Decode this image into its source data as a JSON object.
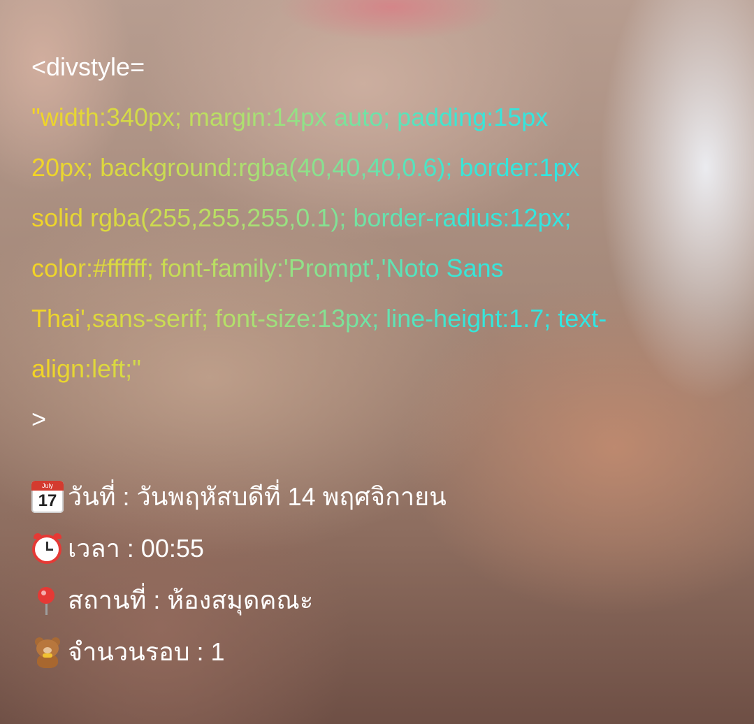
{
  "code": {
    "open_tag": "<divstyle=",
    "style_lines": [
      "\"width:340px; margin:14px auto; padding:15px",
      "20px; background:rgba(40,40,40,0.6); border:1px",
      "solid rgba(255,255,255,0.1); border-radius:12px;",
      "color:#ffffff; font-family:'Prompt','Noto Sans",
      "Thai',sans-serif; font-size:13px; line-height:1.7; text-",
      "align:left;\""
    ],
    "close_bracket": ">"
  },
  "info": {
    "calendar_badge": "July",
    "calendar_day": "17",
    "date_label": "วันที่ : วันพฤหัสบดีที่ 14 พฤศจิกายน",
    "time_label": "เวลา : 00:55",
    "place_label": "สถานที่ : ห้องสมุดคณะ",
    "rounds_label": "จำนวนรอบ : 1"
  },
  "icons": [
    "calendar-icon",
    "alarm-clock-icon",
    "pushpin-icon",
    "teddy-bear-icon"
  ]
}
